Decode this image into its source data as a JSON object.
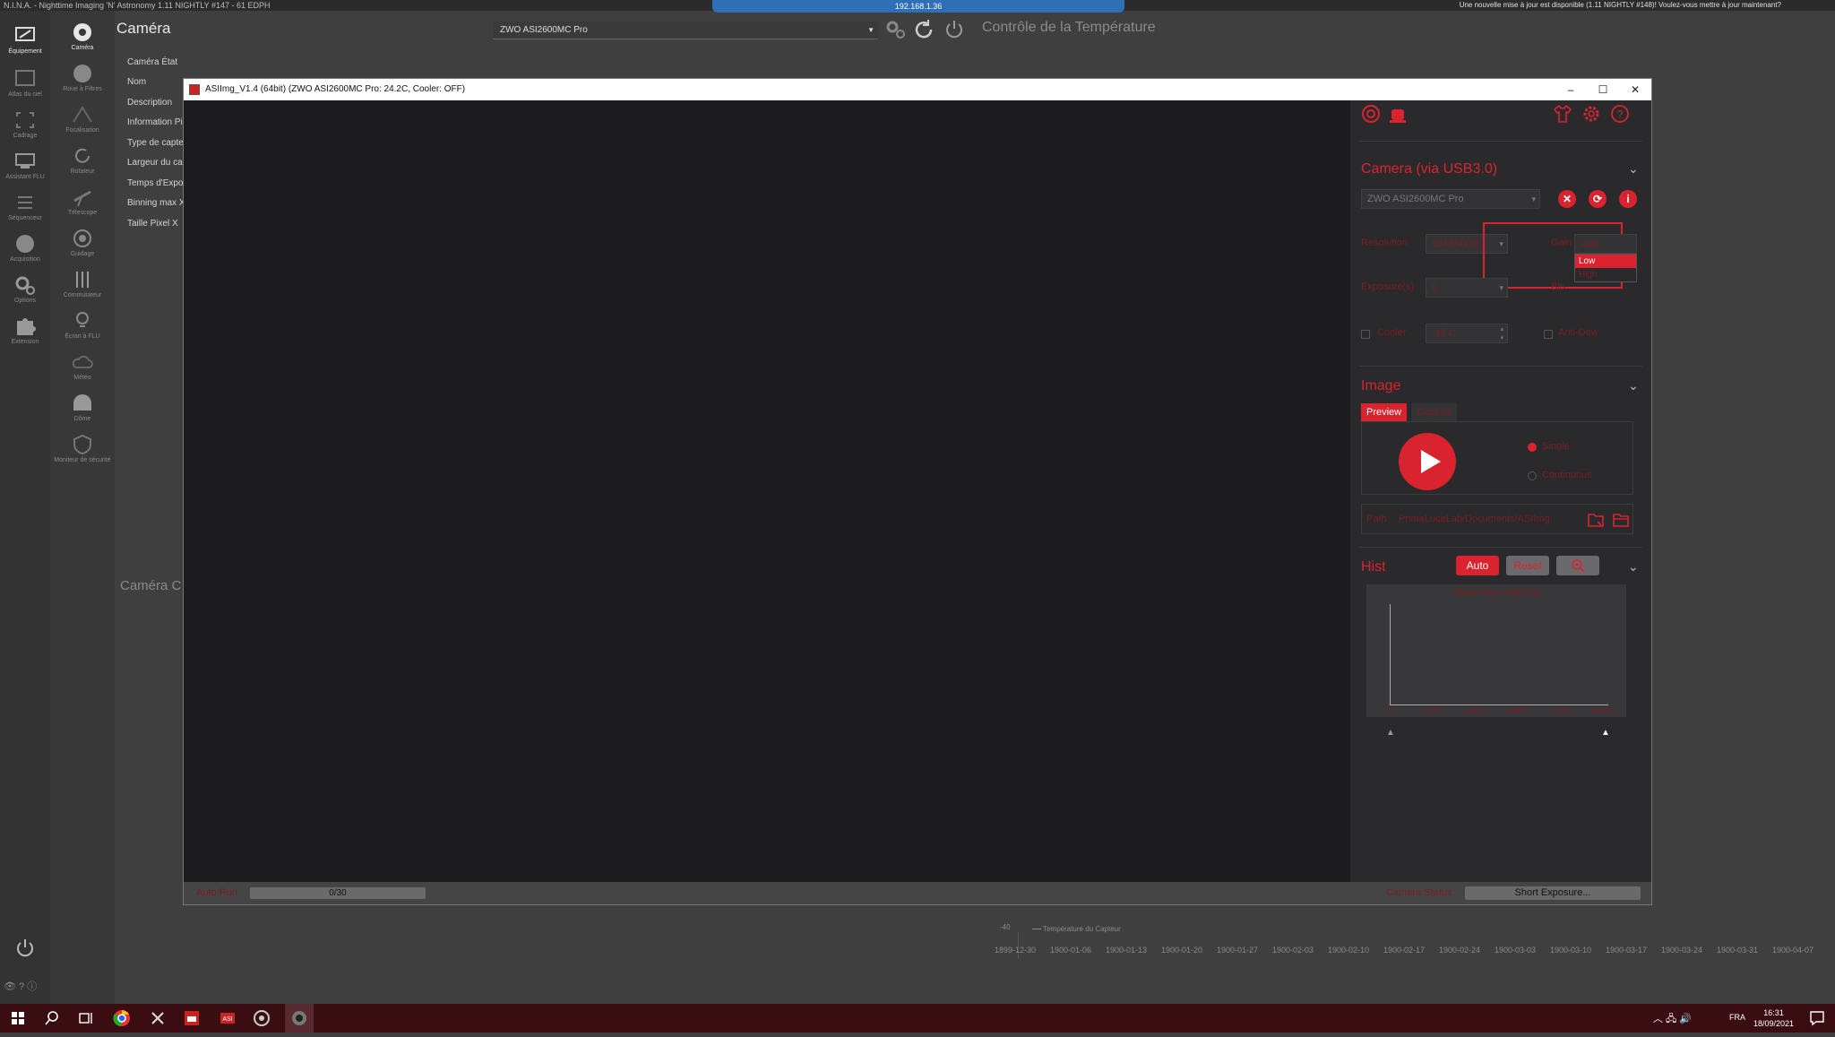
{
  "nina": {
    "title": "N.I.N.A. - Nighttime Imaging 'N' Astronomy 1.11 NIGHTLY #147 - 61 EDPH",
    "update_notice": "Une nouvelle mise à jour est disponible (1.11 NIGHTLY #148)! Voulez-vous mettre à jour maintenant?",
    "rdp_address": "192.168.1.36",
    "nav": [
      {
        "label": "Équipement",
        "icon": "equipment-icon"
      },
      {
        "label": "Atlas du ciel",
        "icon": "sky-atlas-icon"
      },
      {
        "label": "Cadrage",
        "icon": "framing-icon"
      },
      {
        "label": "Assistant FLU",
        "icon": "flat-wizard-icon"
      },
      {
        "label": "Séquenceur",
        "icon": "sequencer-icon"
      },
      {
        "label": "Acquisition",
        "icon": "imaging-icon"
      },
      {
        "label": "Options",
        "icon": "gear-icon"
      },
      {
        "label": "Extension",
        "icon": "puzzle-icon"
      }
    ],
    "subnav": [
      {
        "label": "Caméra",
        "icon": "camera-shutter-icon"
      },
      {
        "label": "Roue à Filtres",
        "icon": "filter-wheel-icon"
      },
      {
        "label": "Focalisation",
        "icon": "focuser-icon"
      },
      {
        "label": "Rotateur",
        "icon": "rotator-icon"
      },
      {
        "label": "Télescope",
        "icon": "telescope-icon"
      },
      {
        "label": "Guidage",
        "icon": "guider-icon"
      },
      {
        "label": "Commutateur",
        "icon": "switch-icon"
      },
      {
        "label": "Écran à FLU",
        "icon": "flat-panel-icon"
      },
      {
        "label": "Météo",
        "icon": "weather-icon"
      },
      {
        "label": "Dôme",
        "icon": "dome-icon"
      },
      {
        "label": "Moniteur de sécurité",
        "icon": "safety-monitor-icon"
      }
    ],
    "page_title": "Caméra",
    "camera_selected": "ZWO ASI2600MC Pro",
    "temp_control_title": "Contrôle de la Température",
    "properties": [
      "Caméra État",
      "Nom",
      "Description",
      "Information Pi",
      "Type de capte",
      "Largeur du cap",
      "Temps d'Expos",
      "Binning max X",
      "Taille Pixel X"
    ],
    "camera_c_label": "Caméra C",
    "temp_chart": {
      "legend": "Température du Capteur",
      "y_tick": "-40",
      "x_ticks": [
        "1899-12-30",
        "1900-01-06",
        "1900-01-13",
        "1900-01-20",
        "1900-01-27",
        "1900-02-03",
        "1900-02-10",
        "1900-02-17",
        "1900-02-24",
        "1900-03-03",
        "1900-03-10",
        "1900-03-17",
        "1900-03-24",
        "1900-03-31",
        "1900-04-07"
      ]
    }
  },
  "asiimg": {
    "title": "ASIImg_V1.4 (64bit)  (ZWO ASI2600MC Pro: 24.2C, Cooler: OFF)",
    "camera_section": "Camera (via USB3.0)",
    "camera_model": "ZWO ASI2600MC Pro",
    "resolution_label": "Resolution",
    "resolution_value": "6248*4176",
    "gain_label": "Gain",
    "gain_value": "Low",
    "gain_options": [
      "Low",
      "High"
    ],
    "exposure_label": "Exposure(s)",
    "exposure_value": "0",
    "bin_label": "Bin",
    "cooler_label": "Cooler",
    "cooler_value": "-15 C",
    "antidew_label": "Anti-Dew",
    "image_section": "Image",
    "tab_preview": "Preview",
    "tab_capture": "Capture",
    "mode_single": "Single",
    "mode_continuous": "Continuous",
    "path_label": "Path",
    "path_value": "PrimaLuceLab/Documents/ASIImg",
    "hist_section": "Hist",
    "hist_auto": "Auto",
    "hist_reset": "Reset",
    "hist_stats": "Mean Mean High Std",
    "hist_ticks": [
      "0",
      "13107",
      "26214",
      "39321",
      "52428",
      "65535"
    ],
    "auto_run_label": "Auto Run",
    "progress": "0/30",
    "camera_status_label": "Camera Status",
    "camera_status": "Short Exposure..."
  },
  "taskbar": {
    "lang": "FRA",
    "time": "16:31",
    "date": "18/09/2021"
  },
  "colors": {
    "accent_red": "#d9232e",
    "dim_red": "#7a1d22",
    "taskbar": "#3a0d13"
  }
}
